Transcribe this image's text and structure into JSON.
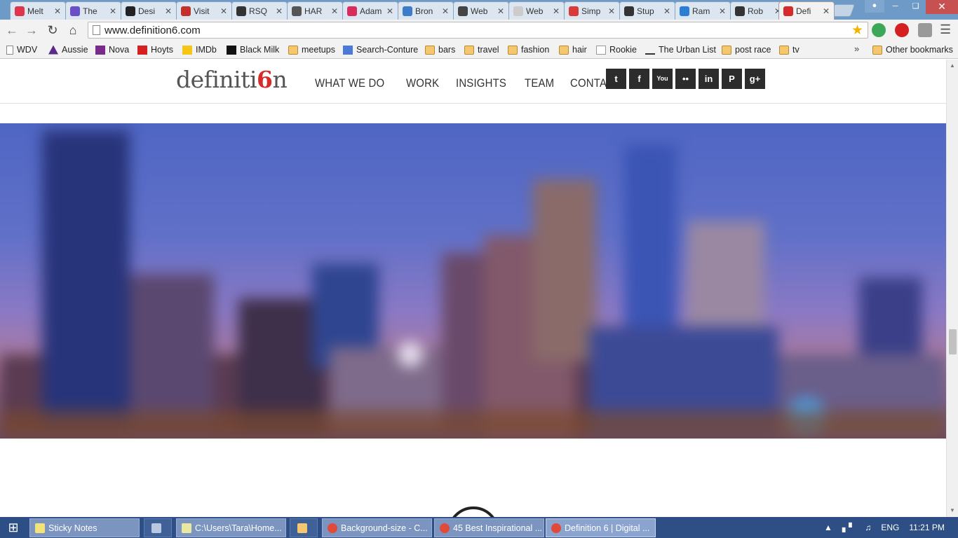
{
  "browser": {
    "tabs": [
      {
        "label": "Melt",
        "color": "#e0344d"
      },
      {
        "label": "The",
        "color": "#6a4fc9"
      },
      {
        "label": "Desi",
        "color": "#222222"
      },
      {
        "label": "Visit",
        "color": "#c2302b"
      },
      {
        "label": "RSQ",
        "color": "#333333"
      },
      {
        "label": "HAR",
        "color": "#555555"
      },
      {
        "label": "Adam",
        "color": "#d92c5a"
      },
      {
        "label": "Bron",
        "color": "#3d7cc9"
      },
      {
        "label": "Web",
        "color": "#444444"
      },
      {
        "label": "Web",
        "color": "#cccccc"
      },
      {
        "label": "Simp",
        "color": "#d93b3b"
      },
      {
        "label": "Stup",
        "color": "#333333"
      },
      {
        "label": "Ram",
        "color": "#2a7fd4"
      },
      {
        "label": "Rob",
        "color": "#333333"
      },
      {
        "label": "Defi",
        "color": "#d62b2b"
      }
    ],
    "url": "www.definition6.com",
    "bookmarks": [
      {
        "label": "WDV",
        "icon": "page-icon"
      },
      {
        "label": "Aussie",
        "icon": "aussie-icon"
      },
      {
        "label": "Nova",
        "icon": "nova-icon"
      },
      {
        "label": "Hoyts",
        "icon": "hoyts-icon"
      },
      {
        "label": "IMDb",
        "icon": "imdb-icon"
      },
      {
        "label": "Black Milk",
        "icon": "bm-icon"
      },
      {
        "label": "meetups",
        "icon": "folder-icon"
      },
      {
        "label": "Search-Conture",
        "icon": "google-icon"
      },
      {
        "label": "bars",
        "icon": "folder-icon"
      },
      {
        "label": "travel",
        "icon": "folder-icon"
      },
      {
        "label": "fashion",
        "icon": "folder-icon"
      },
      {
        "label": "hair",
        "icon": "folder-icon"
      },
      {
        "label": "Rookie",
        "icon": "rookie-icon"
      },
      {
        "label": "The Urban List",
        "icon": "urban-list-icon"
      },
      {
        "label": "post race",
        "icon": "folder-icon"
      },
      {
        "label": "tv",
        "icon": "folder-icon"
      }
    ],
    "overflow_label": "»",
    "other_bookmarks": "Other bookmarks"
  },
  "site": {
    "logo_text_a": "definiti",
    "logo_text_b": "6",
    "logo_text_c": "n",
    "nav": [
      "WHAT WE DO",
      "WORK",
      "INSIGHTS",
      "TEAM",
      "CONTACT"
    ],
    "social": [
      {
        "name": "twitter-icon",
        "glyph": "t"
      },
      {
        "name": "facebook-icon",
        "glyph": "f"
      },
      {
        "name": "youtube-icon",
        "glyph": "You"
      },
      {
        "name": "flickr-icon",
        "glyph": "••"
      },
      {
        "name": "linkedin-icon",
        "glyph": "in"
      },
      {
        "name": "pinterest-icon",
        "glyph": "P"
      },
      {
        "name": "google-plus-icon",
        "glyph": "g+"
      }
    ]
  },
  "taskbar": {
    "items": [
      {
        "label": "Sticky Notes",
        "icon": "sticky-notes-icon",
        "style": "task"
      },
      {
        "label": "",
        "icon": "calculator-icon",
        "style": "plain"
      },
      {
        "label": "C:\\Users\\Tara\\Home...",
        "icon": "notepad-icon",
        "style": "task"
      },
      {
        "label": "",
        "icon": "explorer-icon",
        "style": "plain"
      },
      {
        "label": "Background-size - C...",
        "icon": "chrome-icon",
        "style": "task"
      },
      {
        "label": "45 Best Inspirational ...",
        "icon": "chrome-icon",
        "style": "task"
      },
      {
        "label": "Definition 6 | Digital ...",
        "icon": "chrome-icon",
        "style": "active"
      }
    ],
    "language": "ENG",
    "clock": "11:21 PM"
  }
}
